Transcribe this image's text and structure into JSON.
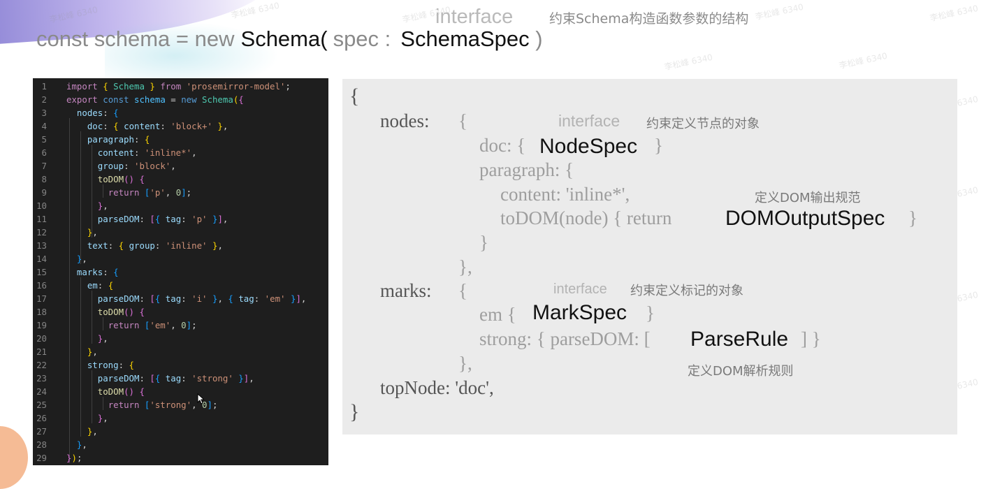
{
  "header": {
    "interface_label": "interface",
    "interface_note": "约束Schema构造函数参数的结构",
    "code_const": "const",
    "code_var": "schema",
    "code_eq": "=",
    "code_new": "new",
    "code_class": "Schema(",
    "code_param": "spec :",
    "code_type": "SchemaSpec",
    "code_close": ")"
  },
  "watermark_text": "李松峰 6340",
  "editor": {
    "line_numbers": [
      "1",
      "2",
      "3",
      "4",
      "5",
      "6",
      "7",
      "8",
      "9",
      "10",
      "11",
      "12",
      "13",
      "14",
      "15",
      "16",
      "17",
      "18",
      "19",
      "20",
      "21",
      "22",
      "23",
      "24",
      "25",
      "26",
      "27",
      "28",
      "29"
    ]
  },
  "panel": {
    "open_brace": "{",
    "close_brace": "}",
    "nodes_key": "nodes:",
    "nodes_brace": "{",
    "nodes_interface": "interface",
    "nodes_note": "约束定义节点的对象",
    "doc_key": "doc: {",
    "doc_type": "NodeSpec",
    "doc_close": "}",
    "paragraph_key": "paragraph: {",
    "content_line": "content:  'inline*',",
    "content_note": "定义DOM输出规范",
    "todom_line": "toDOM(node) {   return",
    "todom_type": "DOMOutputSpec",
    "todom_close": "}",
    "paragraph_close": "}",
    "nodes_close": "},",
    "marks_key": "marks:",
    "marks_brace": "{",
    "marks_interface": "interface",
    "marks_note": "约束定义标记的对象",
    "em_key": "em {",
    "em_type": "MarkSpec",
    "em_close": "}",
    "strong_key": "strong: {  parseDOM: [",
    "strong_type": "ParseRule",
    "strong_close": "] }",
    "marks_close": "},",
    "parse_note": "定义DOM解析规则",
    "topnode_line": "topNode: 'doc',"
  }
}
